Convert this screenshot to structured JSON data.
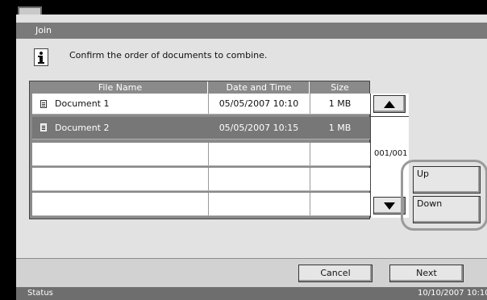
{
  "dialog": {
    "title": "Join",
    "message": "Confirm the order of documents to combine."
  },
  "table": {
    "headers": [
      "File Name",
      "Date and Time",
      "Size"
    ],
    "rows": [
      {
        "name": "Document 1",
        "datetime": "05/05/2007 10:10",
        "size": "1 MB",
        "selected": false
      },
      {
        "name": "Document 2",
        "datetime": "05/05/2007 10:15",
        "size": "1 MB",
        "selected": true
      }
    ],
    "page_indicator": "001/001"
  },
  "buttons": {
    "up": "Up",
    "down": "Down",
    "cancel": "Cancel",
    "next": "Next"
  },
  "status": {
    "label": "Status",
    "datetime": "10/10/2007   10:10"
  },
  "icons": {
    "info": "info-icon",
    "document": "document-icon",
    "scroll_up": "triangle-up-icon",
    "scroll_down": "triangle-down-icon"
  }
}
